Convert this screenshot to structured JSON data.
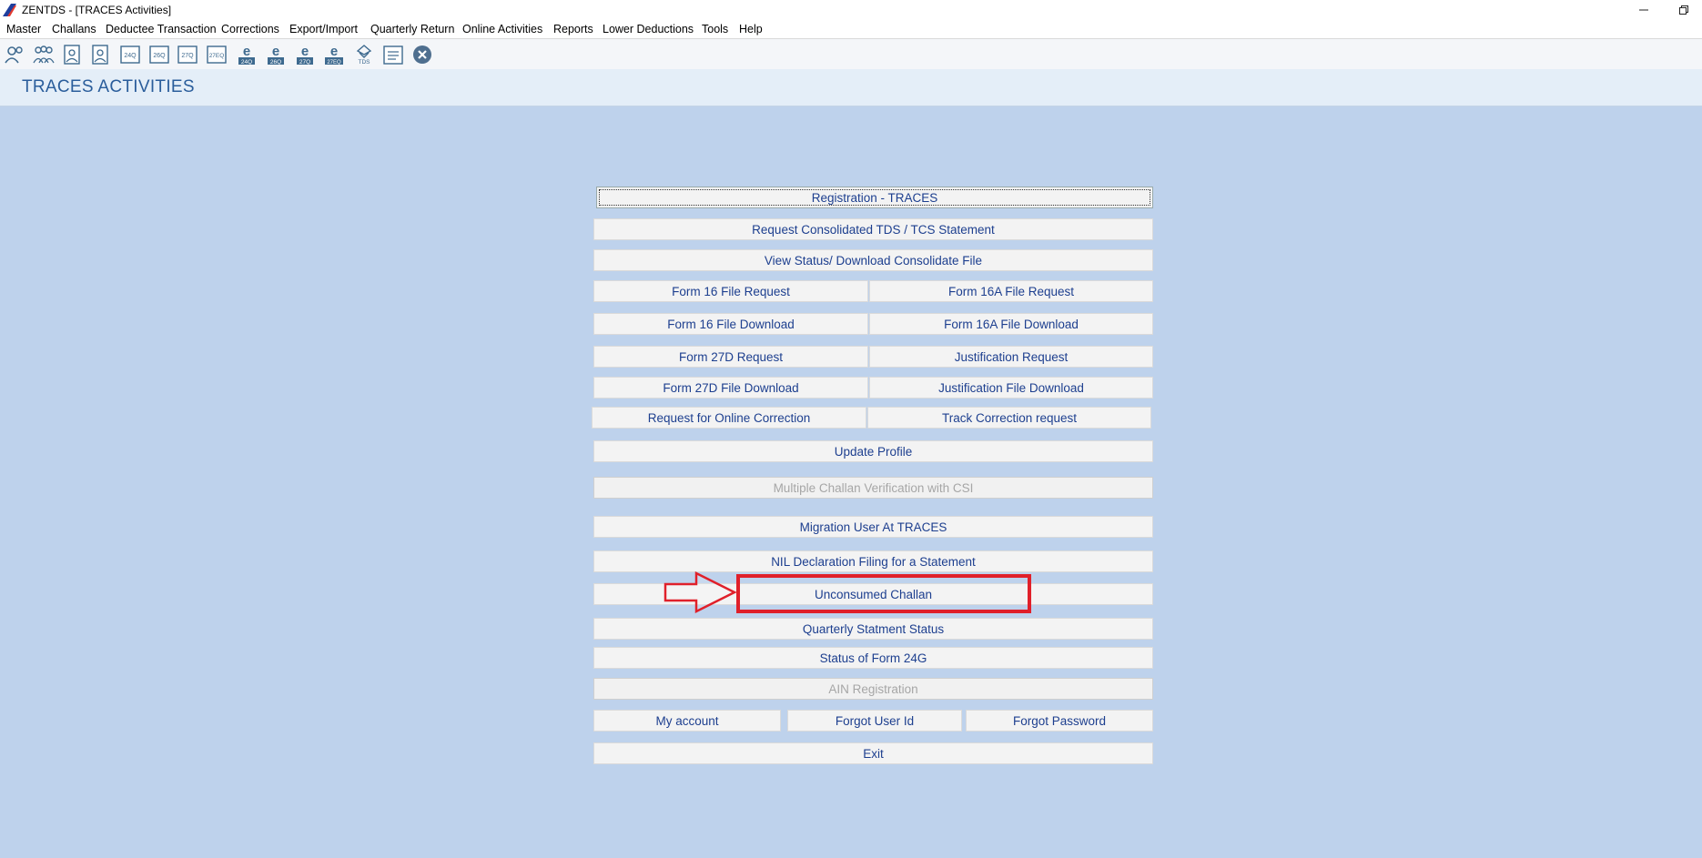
{
  "window": {
    "title": "ZENTDS - [TRACES Activities]"
  },
  "menu": [
    "Master",
    "Challans",
    "Deductee Transaction",
    "Corrections",
    "Export/Import",
    "Quarterly Return",
    "Online Activities",
    "Reports",
    "Lower Deductions",
    "Tools",
    "Help"
  ],
  "toolbar_icons": [
    "deductor-icon",
    "deductees-icon",
    "form-24q-icon",
    "form-26q-icon",
    "form-24q-file-icon",
    "form-26q-file-icon",
    "form-27q-file-icon",
    "form-27eq-file-icon",
    "e-24q-icon",
    "e-26q-icon",
    "e-27q-icon",
    "e-27eq-icon",
    "tds-icon",
    "report-icon",
    "close-icon"
  ],
  "toolbar_labels": {
    "t5": "24Q",
    "t6": "26Q",
    "t7": "27Q",
    "t8": "27EQ",
    "e1": "24Q",
    "e2": "26Q",
    "e3": "27Q",
    "e4": "27EQ",
    "tds": "TDS"
  },
  "header": {
    "title": "TRACES ACTIVITIES"
  },
  "buttons": {
    "registration": "Registration - TRACES",
    "request_consolidated": "Request Consolidated TDS / TCS Statement",
    "view_status": "View Status/ Download Consolidate File",
    "form16_request": "Form 16 File Request",
    "form16a_request": "Form 16A File Request",
    "form16_download": "Form 16 File Download",
    "form16a_download": "Form 16A File Download",
    "form27d_request": "Form 27D Request",
    "justification_request": "Justification Request",
    "form27d_download": "Form 27D File Download",
    "justification_download": "Justification File Download",
    "online_correction": "Request for Online Correction",
    "track_correction": "Track Correction request",
    "update_profile": "Update Profile",
    "multiple_challan": "Multiple Challan Verification with CSI",
    "migration_user": "Migration User At TRACES",
    "nil_declaration": "NIL Declaration Filing for a Statement",
    "unconsumed_challan": "Unconsumed Challan",
    "quarterly_status": "Quarterly Statment Status",
    "status_24g": "Status of Form 24G",
    "ain_registration": "AIN Registration",
    "my_account": "My account",
    "forgot_user": "Forgot User Id",
    "forgot_password": "Forgot Password",
    "exit": "Exit"
  },
  "colors": {
    "background": "#bed2ec",
    "button_text": "#1d3f8f",
    "highlight": "#e0202a",
    "header_text": "#2a5d9b"
  }
}
